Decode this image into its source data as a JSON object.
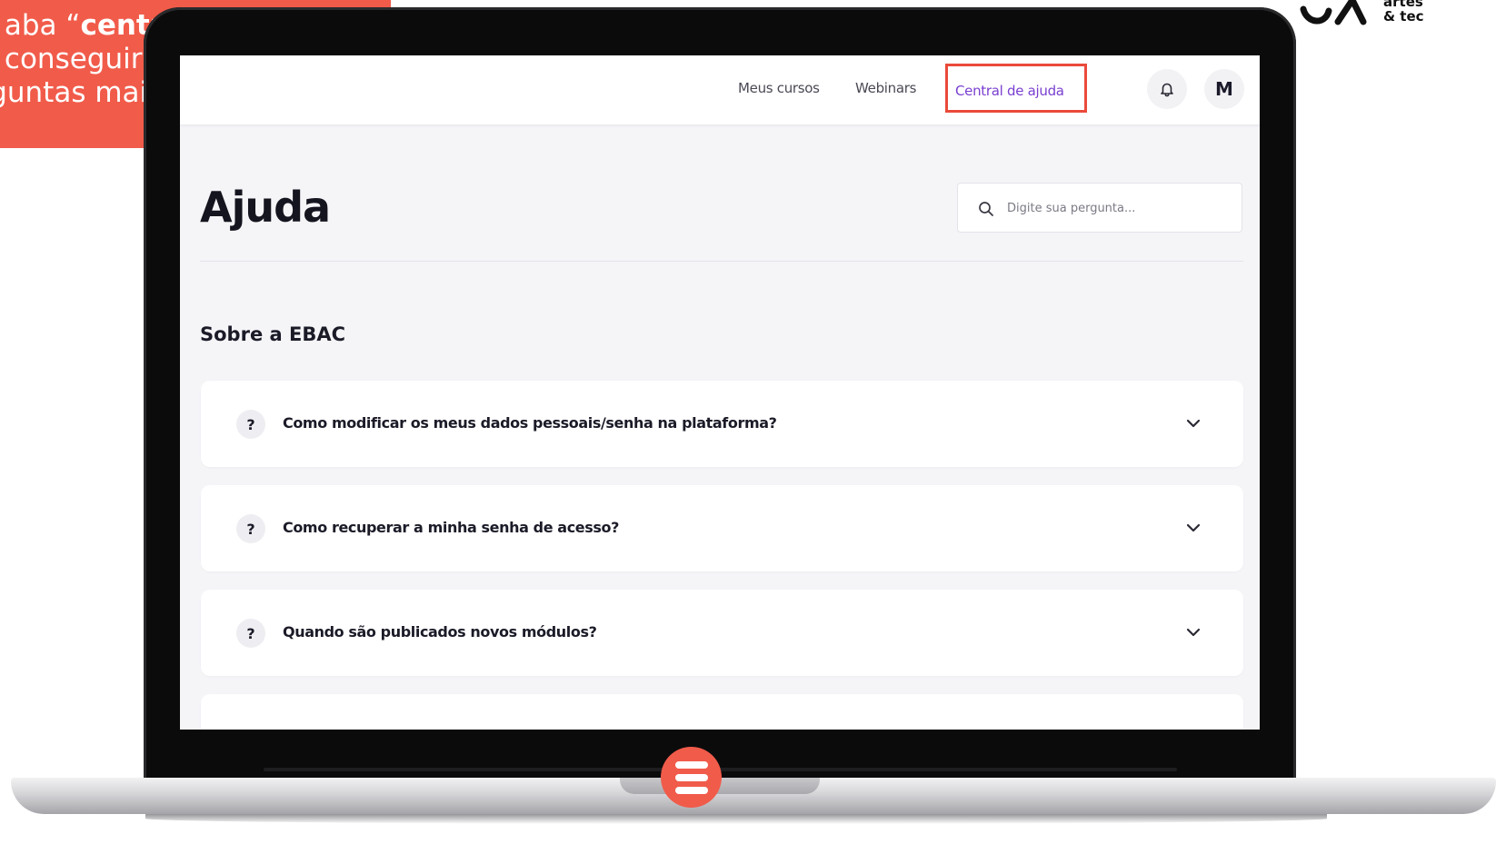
{
  "callout": {
    "line1_pre": "a aba “",
    "line1_bold": "central de ajuda",
    "line1_post": "”",
    "line2": "ê conseguirá visualizar as",
    "line3": "rguntas mais frequentes."
  },
  "brand": {
    "text": "artes\n& tec"
  },
  "navbar": {
    "links": [
      "Meus cursos",
      "Webinars",
      "Central de ajuda"
    ],
    "active_link": "Central de ajuda",
    "bell_icon": "bell-icon",
    "avatar_initial": "M"
  },
  "page": {
    "title": "Ajuda",
    "search_placeholder": "Digite sua pergunta..."
  },
  "section": {
    "title": "Sobre a EBAC",
    "faqs": [
      {
        "badge": "?",
        "question": "Como modificar os meus dados pessoais/senha na plataforma?"
      },
      {
        "badge": "?",
        "question": "Como recuperar a minha senha de acesso?"
      },
      {
        "badge": "?",
        "question": "Quando são publicados novos módulos?"
      }
    ]
  },
  "colors": {
    "accent_red": "#f15b4a",
    "highlight_border": "#ea4a3a",
    "active_link_purple": "#7a3fd1",
    "screen_bg": "#f5f5f8"
  },
  "icons": [
    "search-icon",
    "bell-icon",
    "chevron-down-icon",
    "question-icon",
    "menu-icon"
  ]
}
